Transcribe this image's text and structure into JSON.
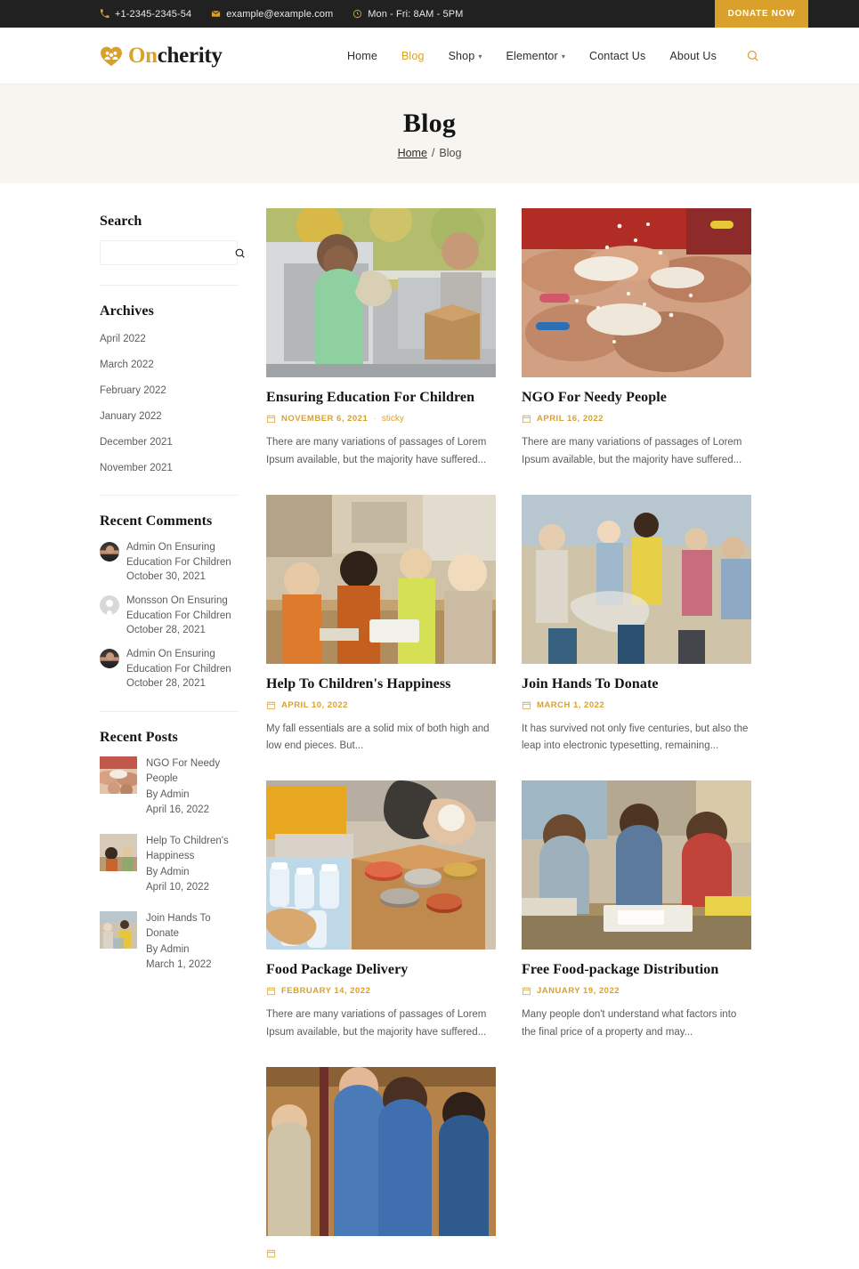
{
  "topbar": {
    "phone": "+1-2345-2345-54",
    "email": "example@example.com",
    "hours": "Mon - Fri: 8AM - 5PM",
    "donate_label": "DONATE NOW",
    "bg_color": "#212121",
    "accent": "#d9a12c"
  },
  "header": {
    "logo_primary": "On",
    "logo_secondary": "cherity",
    "nav": [
      {
        "label": "Home",
        "active": false,
        "caret": false
      },
      {
        "label": "Blog",
        "active": true,
        "caret": false
      },
      {
        "label": "Shop",
        "active": false,
        "caret": true
      },
      {
        "label": "Elementor",
        "active": false,
        "caret": true
      },
      {
        "label": "Contact Us",
        "active": false,
        "caret": false
      },
      {
        "label": "About Us",
        "active": false,
        "caret": false
      }
    ]
  },
  "hero": {
    "title": "Blog",
    "crumb_home": "Home",
    "crumb_sep": "/",
    "crumb_current": "Blog"
  },
  "sidebar": {
    "search": {
      "title": "Search",
      "value": "",
      "placeholder": ""
    },
    "archives": {
      "title": "Archives",
      "items": [
        "April 2022",
        "March 2022",
        "February 2022",
        "January 2022",
        "December 2021",
        "November 2021"
      ]
    },
    "recent_comments": {
      "title": "Recent Comments",
      "items": [
        {
          "author": "Admin",
          "on": "On Ensuring Education For Children",
          "text": "Admin On Ensuring Education For Children",
          "date": "October 30, 2021",
          "avatar": "person"
        },
        {
          "author": "Monsson",
          "on": "On Ensuring Education For Children",
          "text": "Monsson On Ensuring Education For Children",
          "date": "October 28, 2021",
          "avatar": "blank"
        },
        {
          "author": "Admin",
          "on": "On Ensuring Education For Children",
          "text": "Admin On Ensuring Education For Children",
          "date": "October 28, 2021",
          "avatar": "person"
        }
      ]
    },
    "recent_posts": {
      "title": "Recent Posts",
      "items": [
        {
          "title": "NGO For Needy People",
          "by": "By Admin",
          "date": "April 16, 2022",
          "thumb": "rice-hands"
        },
        {
          "title": "Help To Children's Happiness",
          "by": "By Admin",
          "date": "April 10, 2022",
          "thumb": "classroom"
        },
        {
          "title": "Join Hands To Donate",
          "by": "By Admin",
          "date": "March 1, 2022",
          "thumb": "beach-cleanup"
        }
      ]
    }
  },
  "posts": [
    {
      "title": "Ensuring Education For Children",
      "date": "NOVEMBER 6, 2021",
      "sticky": "sticky",
      "excerpt": "There are many variations of passages of Lorem Ipsum available, but the majority have suffered...",
      "image": "food-donation-truck"
    },
    {
      "title": "NGO For Needy People",
      "date": "APRIL 16, 2022",
      "sticky": "",
      "excerpt": "There are many variations of passages of Lorem Ipsum available, but the majority have suffered...",
      "image": "rice-hands"
    },
    {
      "title": "Help To Children's Happiness",
      "date": "APRIL 10, 2022",
      "sticky": "",
      "excerpt": "My fall essentials are a solid mix of both high and low end pieces. But...",
      "image": "classroom"
    },
    {
      "title": "Join Hands To Donate",
      "date": "MARCH 1, 2022",
      "sticky": "",
      "excerpt": "It has survived not only five centuries, but also the leap into electronic typesetting, remaining...",
      "image": "beach-cleanup"
    },
    {
      "title": "Food Package Delivery",
      "date": "FEBRUARY 14, 2022",
      "sticky": "",
      "excerpt": "There are many variations of passages of Lorem Ipsum available, but the majority have suffered...",
      "image": "food-box"
    },
    {
      "title": "Free Food-package Distribution",
      "date": "JANUARY 19, 2022",
      "sticky": "",
      "excerpt": "Many people don't understand what factors into the final price of a property and may...",
      "image": "students-desk"
    },
    {
      "title": "",
      "date": "",
      "sticky": "",
      "excerpt": "",
      "image": "volunteers-kids"
    }
  ]
}
